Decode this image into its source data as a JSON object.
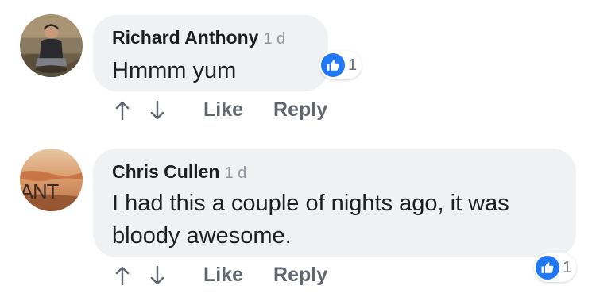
{
  "comments": [
    {
      "author": "Richard Anthony",
      "time": "1 d",
      "text": "Hmmm yum",
      "reaction_count": "1",
      "actions": {
        "like": "Like",
        "reply": "Reply"
      }
    },
    {
      "author": "Chris Cullen",
      "time": "1 d",
      "text_line1": "I had this a couple of nights ago, it was",
      "text_line2": "bloody awesome.",
      "reaction_count": "1",
      "avatar_text": "ANT",
      "actions": {
        "like": "Like",
        "reply": "Reply"
      }
    }
  ],
  "colors": {
    "bubble": "#f0f1f3",
    "like_blue": "#2078f4",
    "meta_gray": "#90949c",
    "action_gray": "#606770"
  }
}
